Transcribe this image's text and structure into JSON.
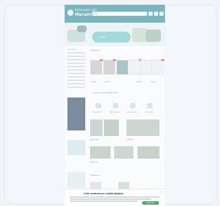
{
  "header": {
    "brand_prefix": "Аптечный сайт",
    "brand_name": "Мегаптека",
    "search_placeholder": "Поиск"
  },
  "banner": {
    "subtitle": "Скидки"
  },
  "sidebar": {
    "title": "Каталог"
  },
  "sections": {
    "products_title": "Новинки",
    "categories_title": "Статьи / Аптечный блог",
    "blog_title": "Блог",
    "bottom_title": "Новинки"
  },
  "products": [
    {
      "badge": "-20%",
      "price": "125 ₽"
    },
    {
      "badge": "-15%",
      "price": "340 ₽"
    },
    {
      "badge": "",
      "price": "210 ₽"
    },
    {
      "badge": "-10%",
      "price": "98 ₽"
    },
    {
      "badge": "",
      "price": "560 ₽"
    },
    {
      "badge": "-5%",
      "price": "720 ₽"
    }
  ],
  "categories": [
    {
      "label": "Лекарства"
    },
    {
      "label": "Витамины"
    },
    {
      "label": "Косметика"
    },
    {
      "label": "Гигиена"
    }
  ],
  "blog": [
    {
      "caption": "Здоровье"
    },
    {
      "caption": "Советы"
    },
    {
      "caption": "Новости"
    }
  ],
  "cookie": {
    "title": "Сайт использует cookie-файлы",
    "close": "×",
    "accept": "Принять"
  }
}
